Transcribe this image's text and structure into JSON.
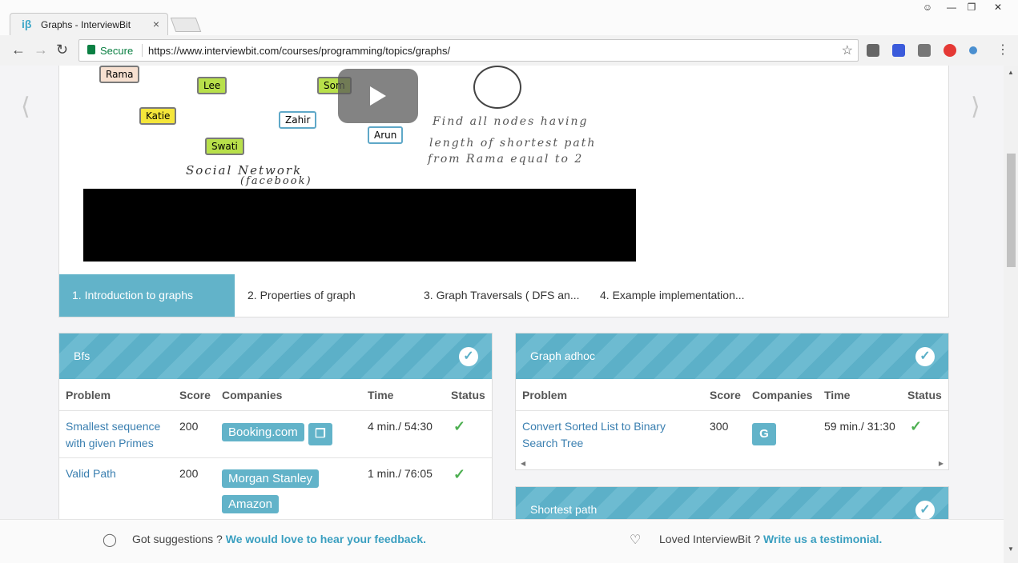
{
  "browser": {
    "tab_logo": "iβ",
    "tab_title": "Graphs - InterviewBit",
    "tab_close": "×",
    "secure_label": "Secure",
    "url": "https://www.interviewbit.com/courses/programming/topics/graphs/"
  },
  "video": {
    "nodes": [
      "Rama",
      "Lee",
      "Som",
      "Katie",
      "Zahir",
      "Arun",
      "Swati"
    ],
    "caption_main": "Social Network",
    "caption_sub": "(facebook)",
    "note_line1": "Find all nodes having",
    "note_line2": "length of shortest path",
    "note_line3": "from Rama equal to 2"
  },
  "lesson_tabs": [
    {
      "label": "1. Introduction to graphs",
      "active": true
    },
    {
      "label": "2. Properties of graph",
      "active": false
    },
    {
      "label": "3. Graph Traversals ( DFS an...",
      "active": false
    },
    {
      "label": "4. Example implementation...",
      "active": false
    }
  ],
  "cards": {
    "bfs": {
      "title": "Bfs",
      "headers": [
        "Problem",
        "Score",
        "Companies",
        "Time",
        "Status"
      ],
      "rows": [
        {
          "problem_line1": "Smallest sequence",
          "problem_line2": "with given Primes",
          "score": "200",
          "companies": [
            "Booking.com"
          ],
          "time": "4 min./ 54:30"
        },
        {
          "problem_line1": "Valid Path",
          "problem_line2": "",
          "score": "200",
          "companies": [
            "Morgan Stanley",
            "Amazon"
          ],
          "time": "1 min./ 76:05"
        }
      ]
    },
    "adhoc": {
      "title": "Graph adhoc",
      "headers": [
        "Problem",
        "Score",
        "Companies",
        "Time",
        "Status"
      ],
      "rows": [
        {
          "problem_line1": "Convert Sorted List to Binary",
          "problem_line2": "Search Tree",
          "score": "300",
          "company_icon": "G",
          "time": "59 min./ 31:30"
        }
      ]
    },
    "shortest": {
      "title": "Shortest path"
    }
  },
  "footer": {
    "suggest_text": "Got suggestions ?",
    "suggest_link": "We would love to hear your feedback.",
    "loved_text": "Loved InterviewBit ?",
    "loved_link": "Write us a testimonial."
  },
  "colors": {
    "accent": "#62b3c9",
    "link": "#3a7fb0",
    "success": "#4caf50"
  }
}
